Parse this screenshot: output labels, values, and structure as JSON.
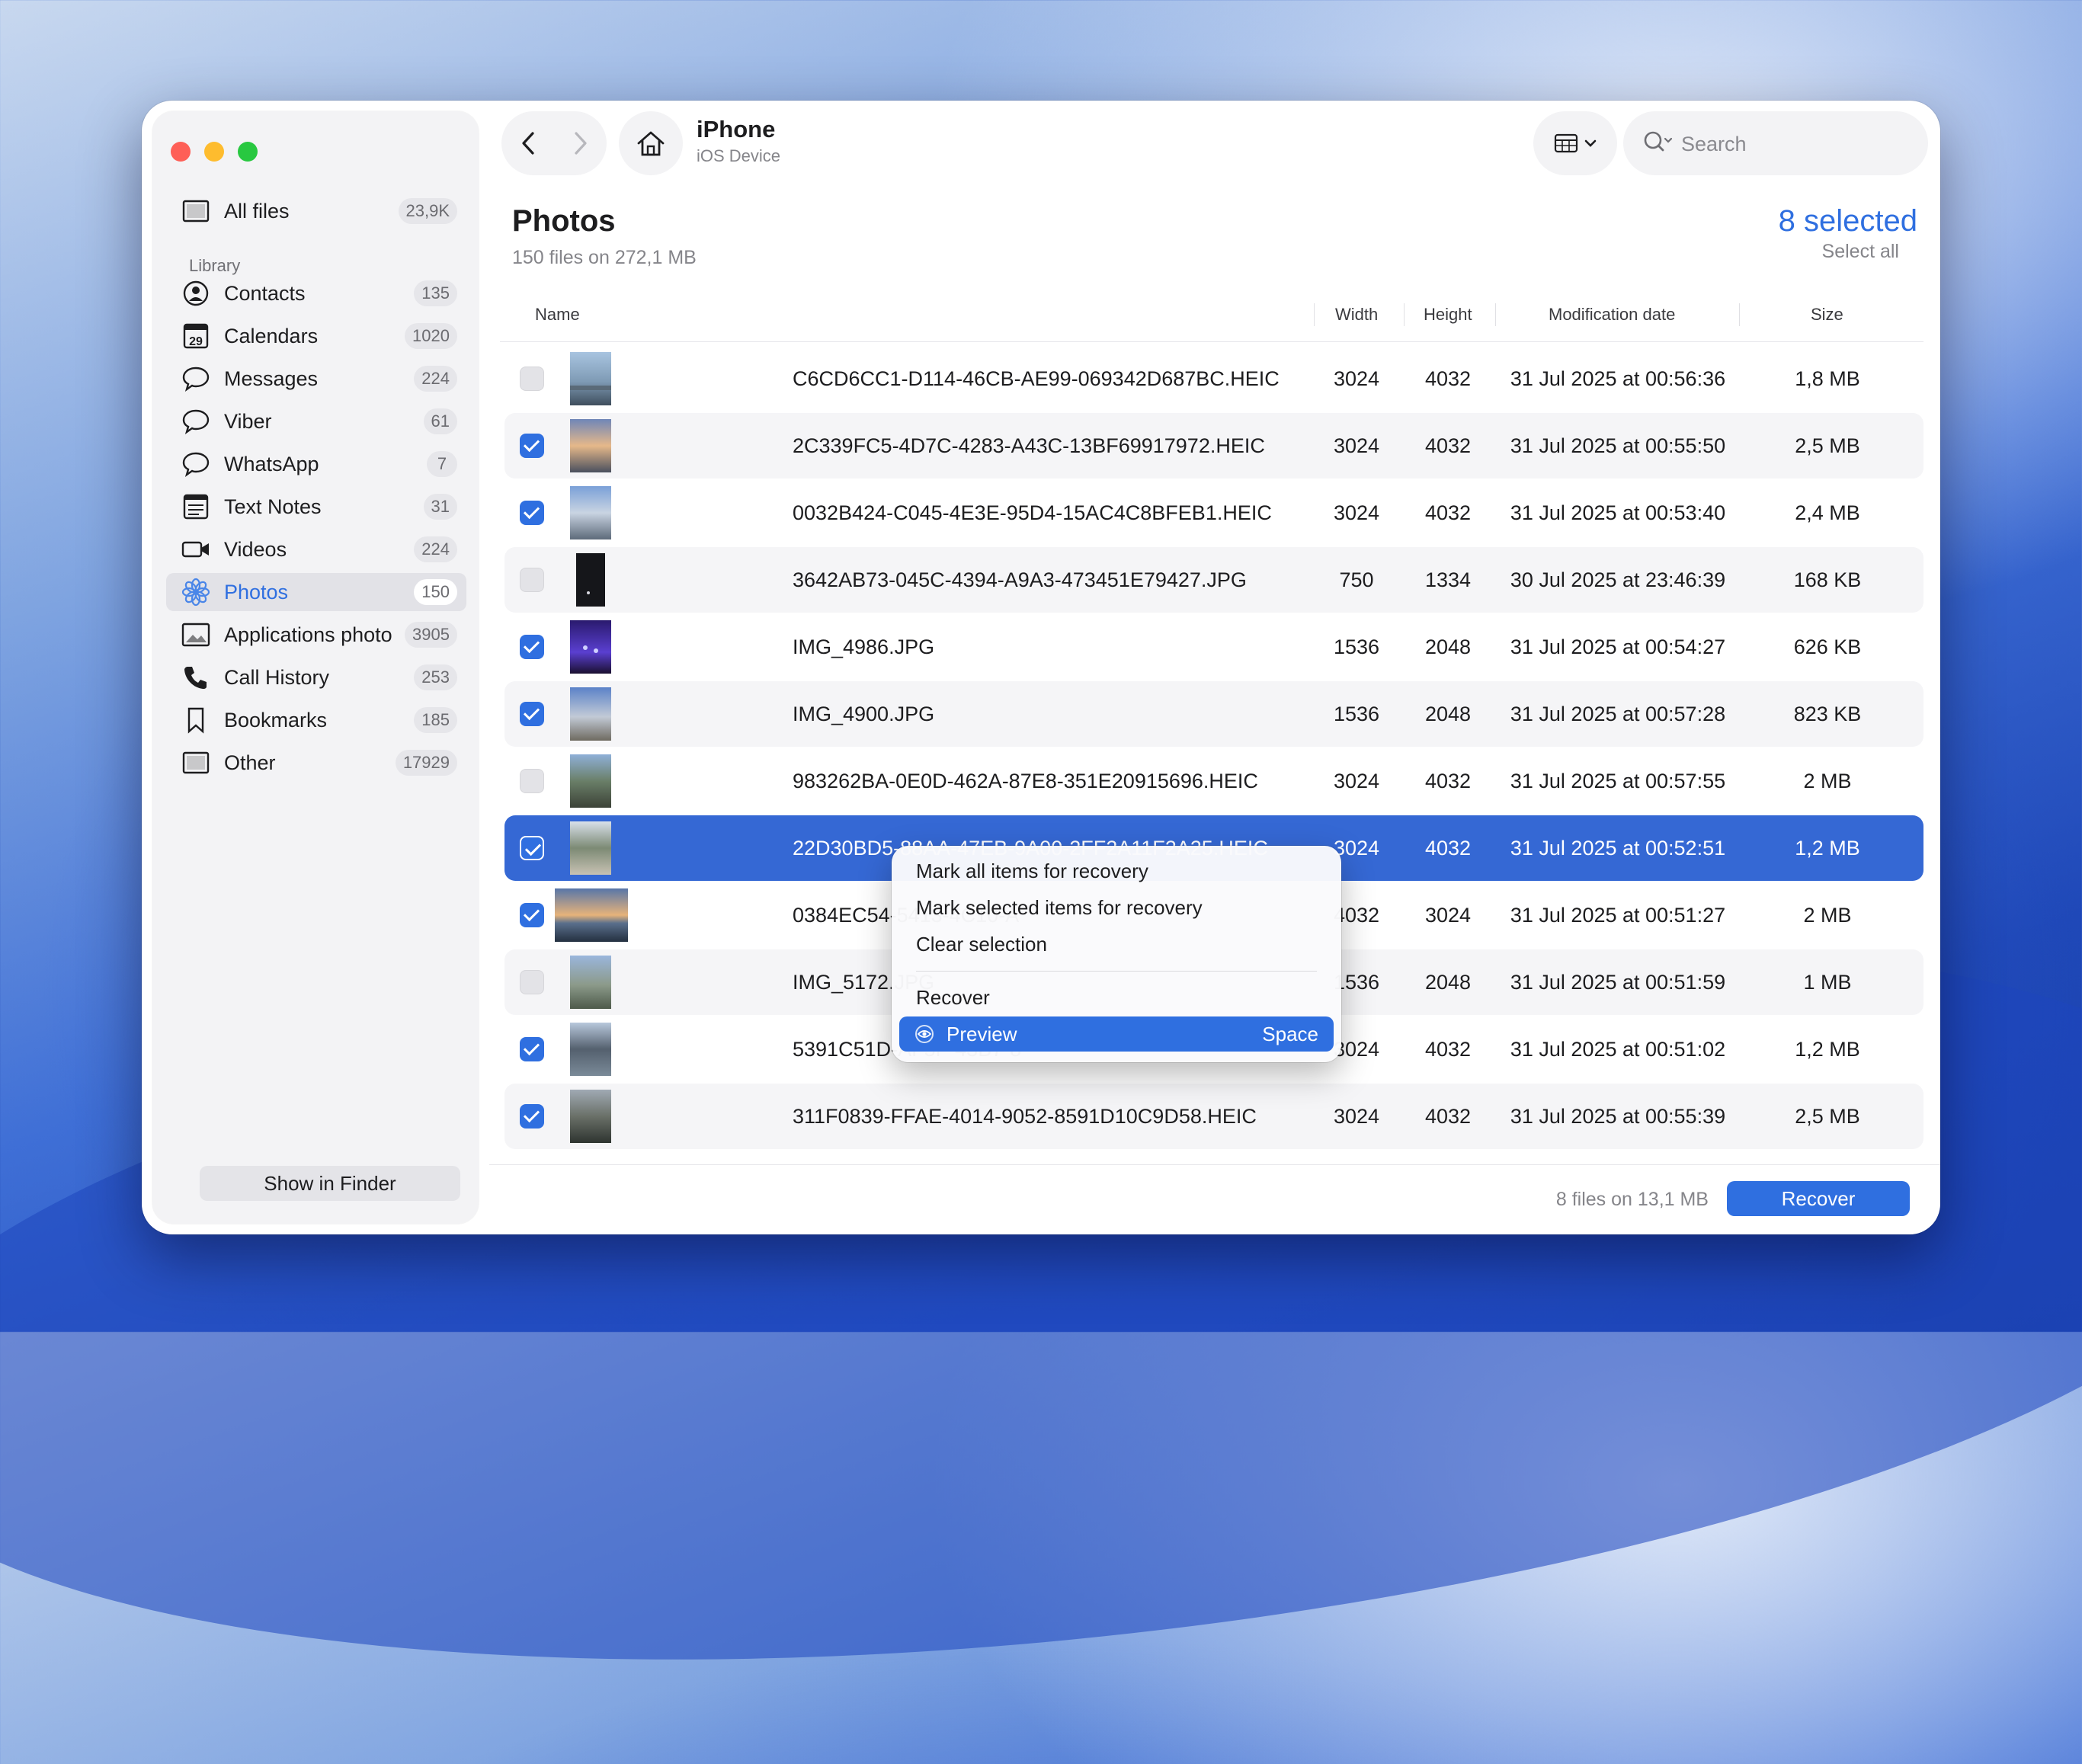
{
  "sidebar": {
    "all_files": {
      "label": "All files",
      "count": "23,9K"
    },
    "section_label": "Library",
    "items": [
      {
        "label": "Contacts",
        "count": "135",
        "icon": "contacts-icon"
      },
      {
        "label": "Calendars",
        "count": "1020",
        "icon": "calendar-icon",
        "icon_text": "29"
      },
      {
        "label": "Messages",
        "count": "224",
        "icon": "messages-icon"
      },
      {
        "label": "Viber",
        "count": "61",
        "icon": "viber-icon"
      },
      {
        "label": "WhatsApp",
        "count": "7",
        "icon": "whatsapp-icon"
      },
      {
        "label": "Text Notes",
        "count": "31",
        "icon": "notes-icon"
      },
      {
        "label": "Videos",
        "count": "224",
        "icon": "video-icon"
      },
      {
        "label": "Photos",
        "count": "150",
        "icon": "photos-icon"
      },
      {
        "label": "Applications photo",
        "count": "3905",
        "icon": "app-photo-icon"
      },
      {
        "label": "Call History",
        "count": "253",
        "icon": "phone-icon"
      },
      {
        "label": "Bookmarks",
        "count": "185",
        "icon": "bookmark-icon"
      },
      {
        "label": "Other",
        "count": "17929",
        "icon": "other-icon"
      }
    ],
    "active_item": "Photos",
    "show_in_finder": "Show in Finder"
  },
  "toolbar": {
    "device_title": "iPhone",
    "device_subtitle": "iOS Device",
    "search_placeholder": "Search"
  },
  "header": {
    "title": "Photos",
    "subtitle": "150 files on 272,1 MB",
    "selected": "8 selected",
    "select_all": "Select all"
  },
  "table": {
    "columns": {
      "name": "Name",
      "width": "Width",
      "height": "Height",
      "date": "Modification date",
      "size": "Size"
    },
    "rows": [
      {
        "name": "C6CD6CC1-D114-46CB-AE99-069342D687BC.HEIC",
        "width": "3024",
        "height": "4032",
        "date": "31 Jul 2025 at 00:56:36",
        "size": "1,8 MB",
        "checked": false
      },
      {
        "name": "2C339FC5-4D7C-4283-A43C-13BF69917972.HEIC",
        "width": "3024",
        "height": "4032",
        "date": "31 Jul 2025 at 00:55:50",
        "size": "2,5 MB",
        "checked": true
      },
      {
        "name": "0032B424-C045-4E3E-95D4-15AC4C8BFEB1.HEIC",
        "width": "3024",
        "height": "4032",
        "date": "31 Jul 2025 at 00:53:40",
        "size": "2,4 MB",
        "checked": true
      },
      {
        "name": "3642AB73-045C-4394-A9A3-473451E79427.JPG",
        "width": "750",
        "height": "1334",
        "date": "30 Jul 2025 at 23:46:39",
        "size": "168 KB",
        "checked": false
      },
      {
        "name": "IMG_4986.JPG",
        "width": "1536",
        "height": "2048",
        "date": "31 Jul 2025 at 00:54:27",
        "size": "626 KB",
        "checked": true
      },
      {
        "name": "IMG_4900.JPG",
        "width": "1536",
        "height": "2048",
        "date": "31 Jul 2025 at 00:57:28",
        "size": "823 KB",
        "checked": true
      },
      {
        "name": "983262BA-0E0D-462A-87E8-351E20915696.HEIC",
        "width": "3024",
        "height": "4032",
        "date": "31 Jul 2025 at 00:57:55",
        "size": "2 MB",
        "checked": false
      },
      {
        "name": "22D30BD5-88AA-47EB-9A00-2FF2A11F2A25.HEIC",
        "width": "3024",
        "height": "4032",
        "date": "31 Jul 2025 at 00:52:51",
        "size": "1,2 MB",
        "checked": true
      },
      {
        "name": "0384EC54-5413-4C10-A",
        "width": "4032",
        "height": "3024",
        "date": "31 Jul 2025 at 00:51:27",
        "size": "2 MB",
        "checked": true
      },
      {
        "name": "IMG_5172.JPG",
        "width": "1536",
        "height": "2048",
        "date": "31 Jul 2025 at 00:51:59",
        "size": "1 MB",
        "checked": false
      },
      {
        "name": "5391C51D-AF5F-43B7-8",
        "width": "3024",
        "height": "4032",
        "date": "31 Jul 2025 at 00:51:02",
        "size": "1,2 MB",
        "checked": true
      },
      {
        "name": "311F0839-FFAE-4014-9052-8591D10C9D58.HEIC",
        "width": "3024",
        "height": "4032",
        "date": "31 Jul 2025 at 00:55:39",
        "size": "2,5 MB",
        "checked": true
      }
    ]
  },
  "context_menu": {
    "mark_all": "Mark all items for recovery",
    "mark_selected": "Mark selected items for recovery",
    "clear": "Clear selection",
    "recover": "Recover",
    "preview": "Preview",
    "preview_shortcut": "Space"
  },
  "footer": {
    "info": "8 files on 13,1 MB",
    "recover": "Recover"
  },
  "colors": {
    "accent": "#2f6fe0",
    "selection_row": "#3568d4"
  }
}
